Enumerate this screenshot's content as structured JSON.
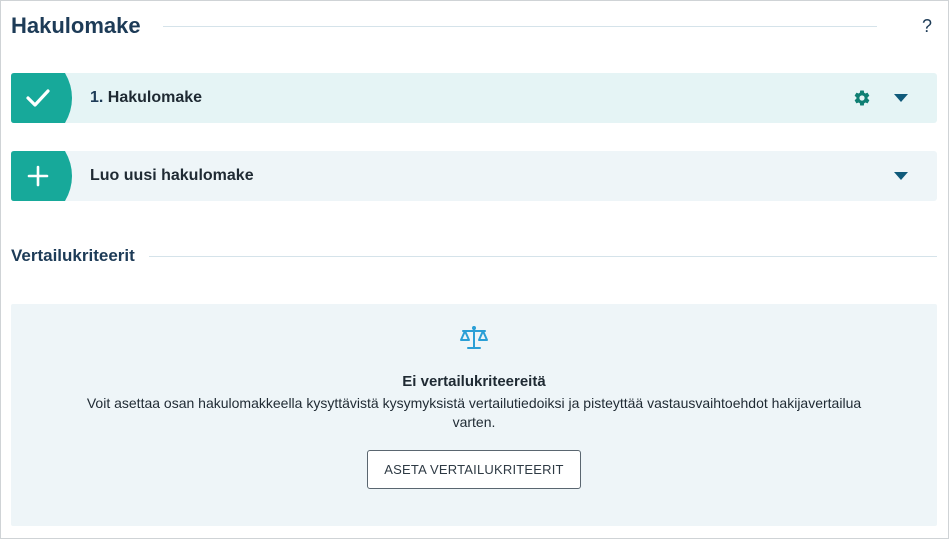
{
  "page": {
    "title": "Hakulomake",
    "help_label": "?"
  },
  "forms": [
    {
      "number": "1.",
      "label": "Hakulomake",
      "status_icon": "check-icon",
      "actions": [
        "gear-icon",
        "chevron-down-icon"
      ]
    },
    {
      "label": "Luo uusi hakulomake",
      "status_icon": "plus-icon",
      "actions": [
        "chevron-down-icon"
      ]
    }
  ],
  "criteria": {
    "title": "Vertailukriteerit",
    "empty_icon": "scale-icon",
    "empty_title": "Ei vertailukriteereitä",
    "empty_description": "Voit asettaa osan hakulomakkeella kysyttävistä kysymyksistä vertailutiedoiksi ja pisteyttää vastausvaihtoehdot hakijavertailua varten.",
    "button_label": "ASETA VERTAILUKRITEERIT"
  },
  "colors": {
    "accent": "#17a99a",
    "heading": "#1d3b57",
    "icon_info": "#2a9fd6",
    "panel_bg": "#eef5f8"
  }
}
